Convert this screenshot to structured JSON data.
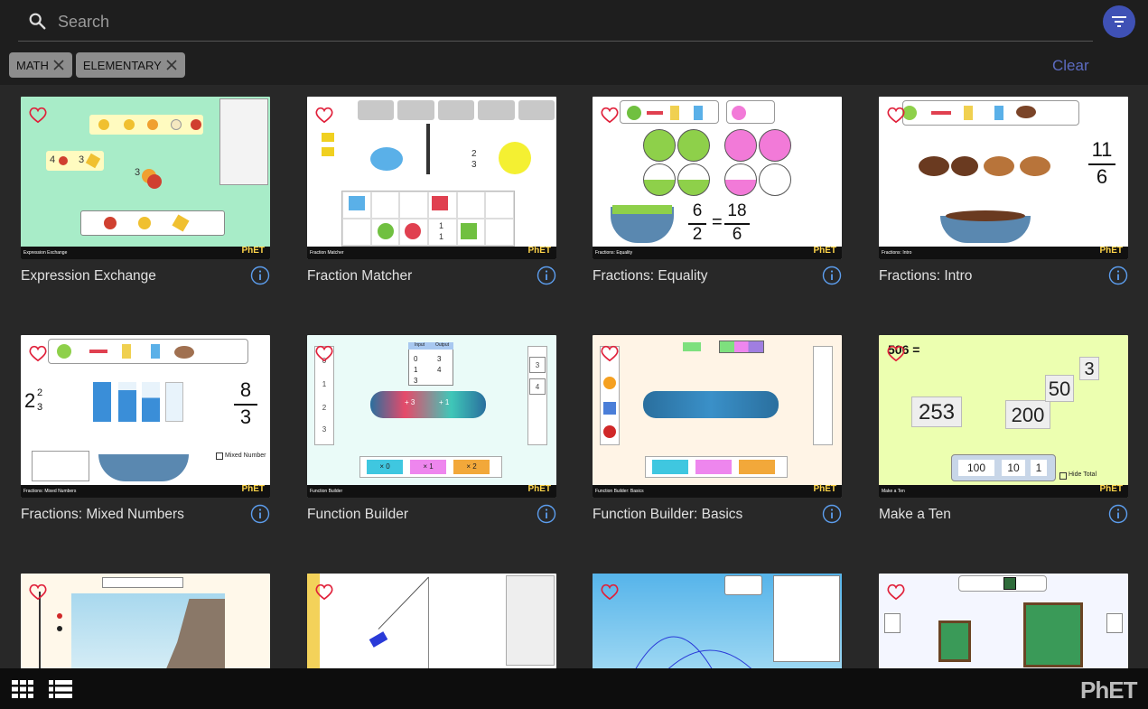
{
  "search": {
    "placeholder": "Search"
  },
  "filters": {
    "chips": [
      "MATH",
      "ELEMENTARY"
    ],
    "clear_label": "Clear"
  },
  "simulations": [
    {
      "title": "Expression Exchange",
      "screen_label": "Expression Exchange",
      "bg": "#a8ecc8"
    },
    {
      "title": "Fraction Matcher",
      "screen_label": "Fraction Matcher",
      "bg": "#ffffff"
    },
    {
      "title": "Fractions: Equality",
      "screen_label": "Fractions: Equality",
      "bg": "#ffffff"
    },
    {
      "title": "Fractions: Intro",
      "screen_label": "Fractions: Intro",
      "bg": "#ffffff"
    },
    {
      "title": "Fractions: Mixed Numbers",
      "screen_label": "Fractions: Mixed Numbers",
      "bg": "#ffffff"
    },
    {
      "title": "Function Builder",
      "screen_label": "Function Builder",
      "bg": "#eafbf8"
    },
    {
      "title": "Function Builder: Basics",
      "screen_label": "Function Builder: Basics",
      "bg": "#fff4e6"
    },
    {
      "title": "Make a Ten",
      "screen_label": "Make a Ten",
      "bg": "#ecffb0"
    },
    {
      "title": "",
      "screen_label": "",
      "bg": "#fff8ea"
    },
    {
      "title": "",
      "screen_label": "",
      "bg": "#ffffff"
    },
    {
      "title": "",
      "screen_label": "",
      "bg": "#def3fb"
    },
    {
      "title": "",
      "screen_label": "",
      "bg": "#f4f6ff"
    }
  ],
  "thumb_text": {
    "fraction_matcher": {
      "two_thirds_num": "2",
      "two_thirds_den": "3",
      "one_num": "1",
      "one_den": "1"
    },
    "fractions_equality": {
      "a_num": "6",
      "a_den": "2",
      "eq": "=",
      "b_num": "18",
      "b_den": "6"
    },
    "fractions_intro": {
      "num": "11",
      "den": "6"
    },
    "mixed_numbers": {
      "whole": "2",
      "num": "2",
      "den": "3",
      "right_num": "8",
      "right_den": "3",
      "checkbox": "Mixed Number"
    },
    "function_builder": {
      "ops": [
        "+ 3",
        "+ 1"
      ],
      "cards": [
        "× 0",
        "× 1",
        "× 2"
      ],
      "table_headers": [
        "Input",
        "Output"
      ],
      "table_rows": [
        [
          "0",
          "3"
        ],
        [
          "1",
          "4"
        ],
        [
          "3",
          ""
        ]
      ],
      "left_values": [
        "0",
        "1",
        "2",
        "3"
      ],
      "right_values": [
        "3",
        "4"
      ]
    },
    "make_a_ten": {
      "equation": "506 =",
      "numbers": [
        "253",
        "200",
        "50",
        "3"
      ],
      "bottom": [
        "100",
        "10",
        "1"
      ],
      "hide_total": "Hide Total"
    },
    "expression_exchange": {
      "n1": "4",
      "n2": "3",
      "n3": "3"
    }
  },
  "brand": {
    "logo": "PhET",
    "accent": "#3f51b5",
    "clear_color": "#5c6bc0"
  }
}
